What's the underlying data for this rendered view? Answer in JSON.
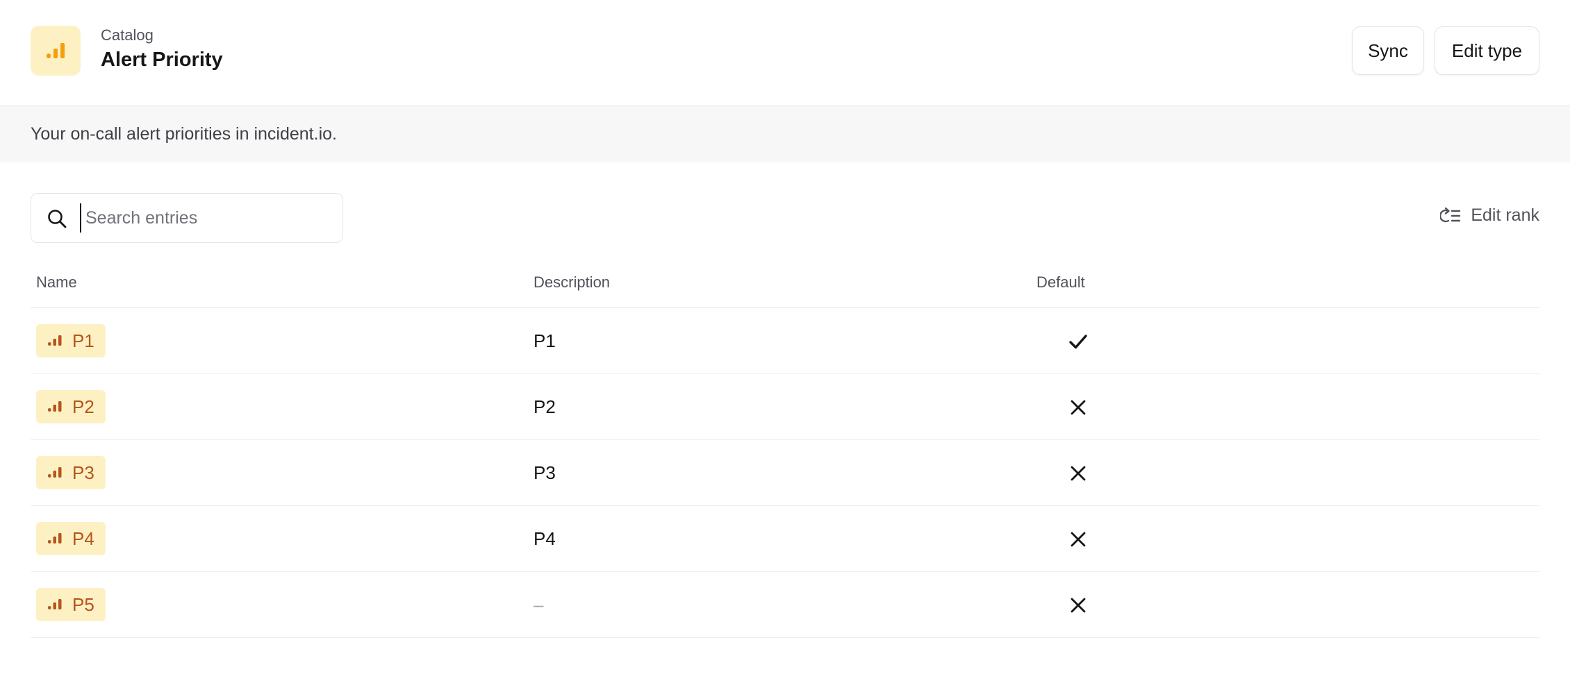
{
  "header": {
    "eyebrow": "Catalog",
    "title": "Alert Priority",
    "icon": "priority-bars-icon",
    "sync_label": "Sync",
    "edit_type_label": "Edit type"
  },
  "description": "Your on-call alert priorities in incident.io.",
  "search": {
    "placeholder": "Search entries",
    "value": ""
  },
  "edit_rank_label": "Edit rank",
  "table": {
    "columns": {
      "name": "Name",
      "description": "Description",
      "default": "Default"
    },
    "rows": [
      {
        "name": "P1",
        "description": "P1",
        "default": true
      },
      {
        "name": "P2",
        "description": "P2",
        "default": false
      },
      {
        "name": "P3",
        "description": "P3",
        "default": false
      },
      {
        "name": "P4",
        "description": "P4",
        "default": false
      },
      {
        "name": "P5",
        "description": "–",
        "default": false
      }
    ]
  },
  "colors": {
    "badge_bg": "#fdf1c4",
    "badge_text": "#b5541c",
    "icon_bar": "#d97706",
    "icon_bar_light": "#f59e0b"
  }
}
